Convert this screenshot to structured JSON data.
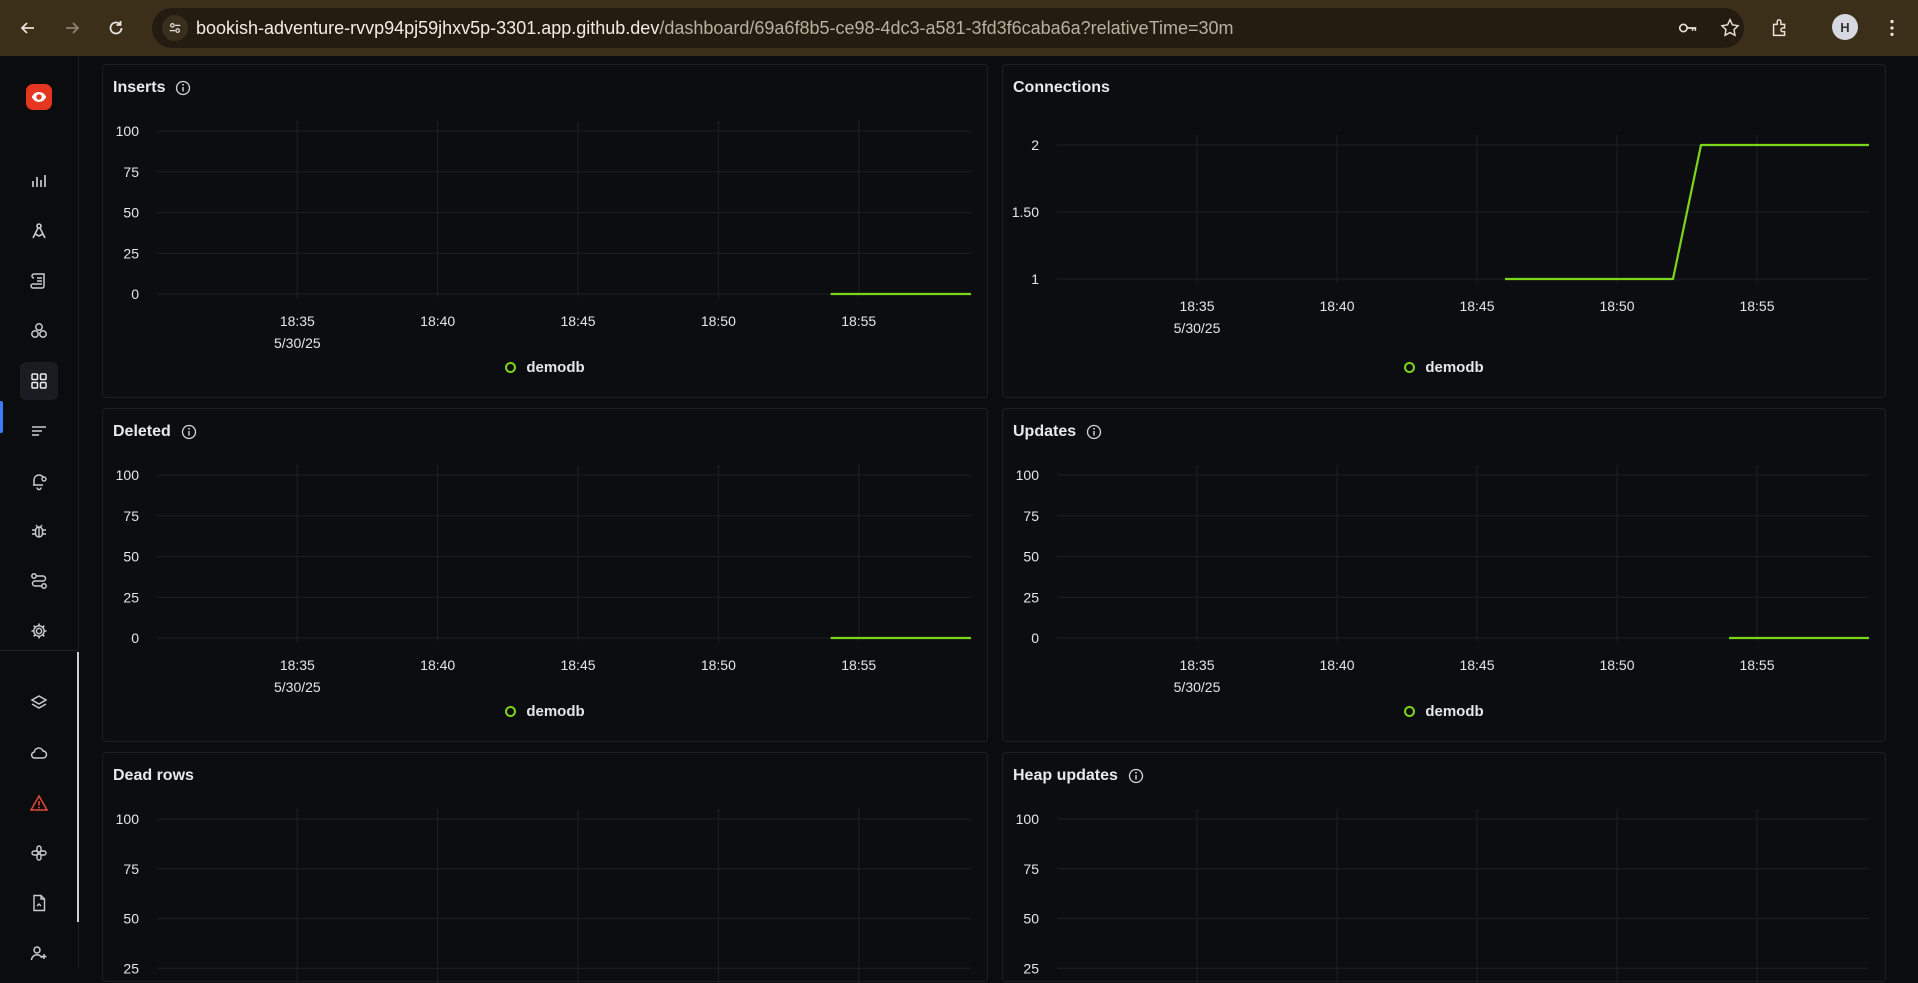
{
  "browser": {
    "url_host": "bookish-adventure-rvvp94pj59jhxv5p-3301.app.github.dev",
    "url_path": "/dashboard/69a6f8b5-ce98-4dc3-a581-3fd3f6caba6a?relativeTime=30m",
    "avatar_label": "H"
  },
  "sidebar": {
    "items": [
      {
        "icon": "bar-chart-icon"
      },
      {
        "icon": "query-icon"
      },
      {
        "icon": "logs-icon"
      },
      {
        "icon": "components-icon"
      },
      {
        "icon": "dashboard-grid-icon"
      },
      {
        "icon": "list-icon"
      },
      {
        "icon": "alert-bell-icon"
      },
      {
        "icon": "bug-icon"
      },
      {
        "icon": "pipeline-icon"
      },
      {
        "icon": "settings-icon"
      },
      {
        "icon": "layers-icon"
      },
      {
        "icon": "cloud-icon"
      },
      {
        "icon": "warning-icon"
      },
      {
        "icon": "integrations-icon"
      },
      {
        "icon": "document-icon"
      },
      {
        "icon": "invite-user-icon"
      }
    ]
  },
  "colors": {
    "series": "#7bd61a",
    "grid": "#1e2025",
    "logo": "#e5361f",
    "active": "#3d7bfd"
  },
  "panels": [
    {
      "id": "inserts",
      "title": "Inserts",
      "info": true,
      "legend": "demodb",
      "chart_data": {
        "type": "line",
        "x_ticks": [
          "18:35",
          "18:40",
          "18:45",
          "18:50",
          "18:55"
        ],
        "x_date": "5/30/25",
        "y_ticks": [
          "100",
          "75",
          "50",
          "25",
          "0"
        ],
        "ylim": [
          0,
          100
        ],
        "x_range": [
          "18:30",
          "18:59"
        ],
        "series": [
          {
            "name": "demodb",
            "x": [
              "18:54",
              "18:59"
            ],
            "y": [
              0,
              0
            ]
          }
        ]
      }
    },
    {
      "id": "connections",
      "title": "Connections",
      "info": false,
      "legend": "demodb",
      "chart_data": {
        "type": "line",
        "x_ticks": [
          "18:35",
          "18:40",
          "18:45",
          "18:50",
          "18:55"
        ],
        "x_date": "5/30/25",
        "y_ticks": [
          "2",
          "1.50",
          "1"
        ],
        "ylim": [
          1,
          2
        ],
        "x_range": [
          "18:30",
          "18:59"
        ],
        "series": [
          {
            "name": "demodb",
            "x": [
              "18:46",
              "18:52",
              "18:53",
              "18:59"
            ],
            "y": [
              1,
              1,
              2,
              2
            ]
          }
        ]
      }
    },
    {
      "id": "deleted",
      "title": "Deleted",
      "info": true,
      "legend": "demodb",
      "chart_data": {
        "type": "line",
        "x_ticks": [
          "18:35",
          "18:40",
          "18:45",
          "18:50",
          "18:55"
        ],
        "x_date": "5/30/25",
        "y_ticks": [
          "100",
          "75",
          "50",
          "25",
          "0"
        ],
        "ylim": [
          0,
          100
        ],
        "x_range": [
          "18:30",
          "18:59"
        ],
        "series": [
          {
            "name": "demodb",
            "x": [
              "18:54",
              "18:59"
            ],
            "y": [
              0,
              0
            ]
          }
        ]
      }
    },
    {
      "id": "updates",
      "title": "Updates",
      "info": true,
      "legend": "demodb",
      "chart_data": {
        "type": "line",
        "x_ticks": [
          "18:35",
          "18:40",
          "18:45",
          "18:50",
          "18:55"
        ],
        "x_date": "5/30/25",
        "y_ticks": [
          "100",
          "75",
          "50",
          "25",
          "0"
        ],
        "ylim": [
          0,
          100
        ],
        "x_range": [
          "18:30",
          "18:59"
        ],
        "series": [
          {
            "name": "demodb",
            "x": [
              "18:54",
              "18:59"
            ],
            "y": [
              0,
              0
            ]
          }
        ]
      }
    },
    {
      "id": "dead-rows",
      "title": "Dead rows",
      "info": false,
      "legend": "",
      "chart_data": {
        "type": "line",
        "x_ticks": [],
        "x_date": "",
        "y_ticks": [
          "100",
          "75",
          "50",
          "25"
        ],
        "ylim": [
          0,
          100
        ],
        "x_range": [
          "18:30",
          "18:59"
        ],
        "series": []
      }
    },
    {
      "id": "heap-updates",
      "title": "Heap updates",
      "info": true,
      "legend": "",
      "chart_data": {
        "type": "line",
        "x_ticks": [],
        "x_date": "",
        "y_ticks": [
          "100",
          "75",
          "50",
          "25"
        ],
        "ylim": [
          0,
          100
        ],
        "x_range": [
          "18:30",
          "18:59"
        ],
        "series": []
      }
    }
  ]
}
